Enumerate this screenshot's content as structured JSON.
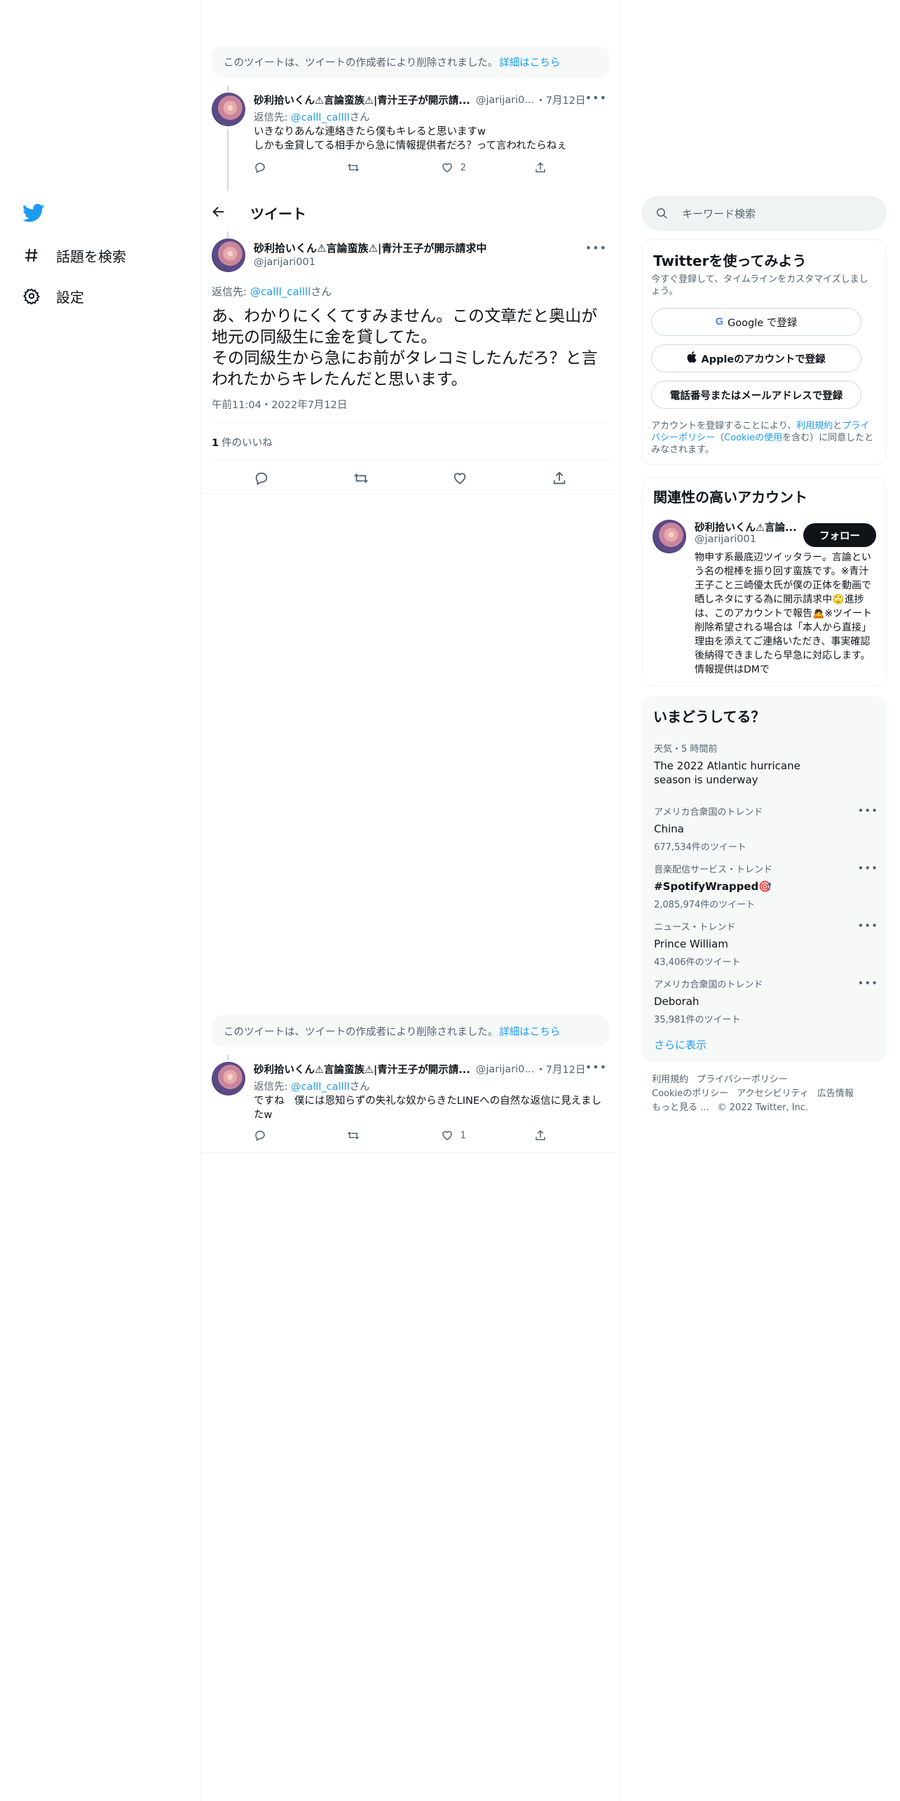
{
  "nav": {
    "explore_label": "話題を検索",
    "settings_label": "設定"
  },
  "header": {
    "title": "ツイート"
  },
  "deleted_notice": {
    "text": "このツイートは、ツイートの作成者により削除されました。",
    "link": "詳細はこちら"
  },
  "tweet_top": {
    "name": "砂利拾いくん⚠言論蛮族⚠|青汁王子が開示請...",
    "handle": "@jarijari0...",
    "date": "・7月12日",
    "reply_prefix": "返信先: ",
    "reply_user": "@calll_callll",
    "reply_suffix": "さん",
    "body": "いきなりあんな連絡きたら僕もキレると思いますw\nしかも金貸してる相手から急に情報提供者だろ？って言われたらねぇ",
    "likes": "2"
  },
  "focal": {
    "name": "砂利拾いくん⚠言論蛮族⚠|青汁王子が開示請求中",
    "handle": "@jarijari001",
    "reply_prefix": "返信先: ",
    "reply_user": "@calll_callll",
    "reply_suffix": "さん",
    "text": "あ、わかりにくくてすみません。この文章だと奥山が地元の同級生に金を貸してた。\nその同級生から急にお前がタレコミしたんだろ？と言われたからキレたんだと思います。",
    "time": "午前11:04・2022年7月12日",
    "likes_count": "1",
    "likes_label": "件のいいね"
  },
  "deleted_notice_2": {
    "text": "このツイートは、ツイートの作成者により削除されました。",
    "link": "詳細はこちら"
  },
  "tweet_bottom": {
    "name": "砂利拾いくん⚠言論蛮族⚠|青汁王子が開示請...",
    "handle": "@jarijari0...",
    "date": "・7月12日",
    "reply_prefix": "返信先: ",
    "reply_user": "@calll_callll",
    "reply_suffix": "さん",
    "body": "ですね　僕には恩知らずの失礼な奴からきたLINEへの自然な返信に見えましたw",
    "likes": "1"
  },
  "search": {
    "placeholder": "キーワード検索"
  },
  "signup": {
    "title": "Twitterを使ってみよう",
    "subtitle": "今すぐ登録して、タイムラインをカスタマイズしましょう。",
    "google_btn": "Google で登録",
    "apple_btn": "Appleのアカウントで登録",
    "phone_btn": "電話番号またはメールアドレスで登録",
    "legal_1": "アカウントを登録することにより、",
    "legal_terms": "利用規約",
    "legal_2": "と",
    "legal_privacy": "プライバシーポリシー",
    "legal_3": "（",
    "legal_cookie": "Cookieの使用",
    "legal_4": "を含む）に同意したとみなされます。"
  },
  "related": {
    "title": "関連性の高いアカウント",
    "name": "砂利拾いくん⚠言論...",
    "handle": "@jarijari001",
    "follow": "フォロー",
    "bio": "物申す系最底辺ツイッタラー。言論という名の棍棒を振り回す蛮族です。※青汁王子こと三崎優太氏が僕の正体を動画で晒しネタにする為に開示請求中🙄進捗は、このアカウントで報告🙇※ツイート削除希望される場合は「本人から直接」理由を添えてご連絡いただき、事実確認後納得できましたら早急に対応します。情報提供はDMで"
  },
  "trends": {
    "title": "いまどうしてる？",
    "items": [
      {
        "category": "天気・5 時間前",
        "name": "The 2022 Atlantic hurricane season is underway",
        "count": ""
      },
      {
        "category": "アメリカ合衆国のトレンド",
        "name": "China",
        "count": "677,534件のツイート"
      },
      {
        "category": "音楽配信サービス・トレンド",
        "name": "#SpotifyWrapped🎯",
        "count": "2,085,974件のツイート"
      },
      {
        "category": "ニュース・トレンド",
        "name": "Prince William",
        "count": "43,406件のツイート"
      },
      {
        "category": "アメリカ合衆国のトレンド",
        "name": "Deborah",
        "count": "35,981件のツイート"
      }
    ],
    "show_more": "さらに表示"
  },
  "footer": {
    "terms": "利用規約",
    "privacy": "プライバシーポリシー",
    "cookie": "Cookieのポリシー",
    "accessibility": "アクセシビリティ",
    "ads": "広告情報",
    "more": "もっと見る ...",
    "copyright": "© 2022 Twitter, Inc."
  },
  "colors": {
    "accent": "#1d9bf0",
    "text": "#0f1419",
    "secondary": "#536471"
  }
}
